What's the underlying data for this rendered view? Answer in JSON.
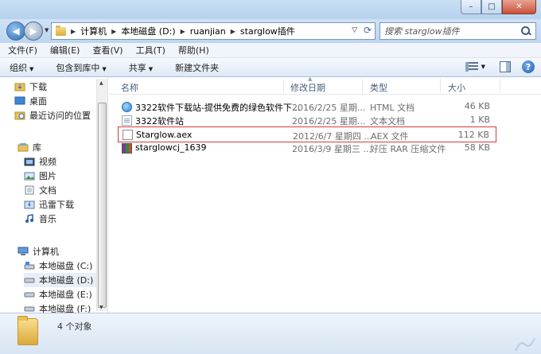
{
  "window": {
    "min_symbol": "–",
    "max_symbol": "□",
    "close_symbol": "✕"
  },
  "address": {
    "breadcrumbs": [
      "计算机",
      "本地磁盘 (D:)",
      "ruanjian",
      "starglow插件"
    ],
    "search_placeholder": "搜索 starglow插件"
  },
  "menu": [
    "文件(F)",
    "编辑(E)",
    "查看(V)",
    "工具(T)",
    "帮助(H)"
  ],
  "toolbar": {
    "organize": "组织",
    "include_in_library": "包含到库中",
    "share": "共享",
    "new_folder": "新建文件夹",
    "help_symbol": "?"
  },
  "nav": {
    "favorites": [
      "下载",
      "桌面",
      "最近访问的位置"
    ],
    "libraries_label": "库",
    "libraries": [
      "视频",
      "图片",
      "文档",
      "迅雷下载",
      "音乐"
    ],
    "computer_label": "计算机",
    "drives": [
      "本地磁盘 (C:)",
      "本地磁盘 (D:)",
      "本地磁盘 (E:)",
      "本地磁盘 (F:)"
    ],
    "selected": "本地磁盘 (D:)"
  },
  "columns": {
    "name": "名称",
    "date": "修改日期",
    "type": "类型",
    "size": "大小"
  },
  "files": [
    {
      "name": "3322软件下载站-提供免费的绿色软件下...",
      "date": "2016/2/25 星期...",
      "type": "HTML 文档",
      "size": "46 KB",
      "icon": "ie-html-icon"
    },
    {
      "name": "3322软件站",
      "date": "2016/2/25 星期...",
      "type": "文本文档",
      "size": "1 KB",
      "icon": "text-document-icon"
    },
    {
      "name": "Starglow.aex",
      "date": "2012/6/7 星期四 ...",
      "type": "AEX 文件",
      "size": "112 KB",
      "icon": "aex-file-icon",
      "highlighted": true
    },
    {
      "name": "starglowcj_1639",
      "date": "2016/3/9 星期三 ...",
      "type": "好压 RAR 压缩文件",
      "size": "58 KB",
      "icon": "rar-archive-icon"
    }
  ],
  "status": {
    "item_count": "4 个对象"
  }
}
